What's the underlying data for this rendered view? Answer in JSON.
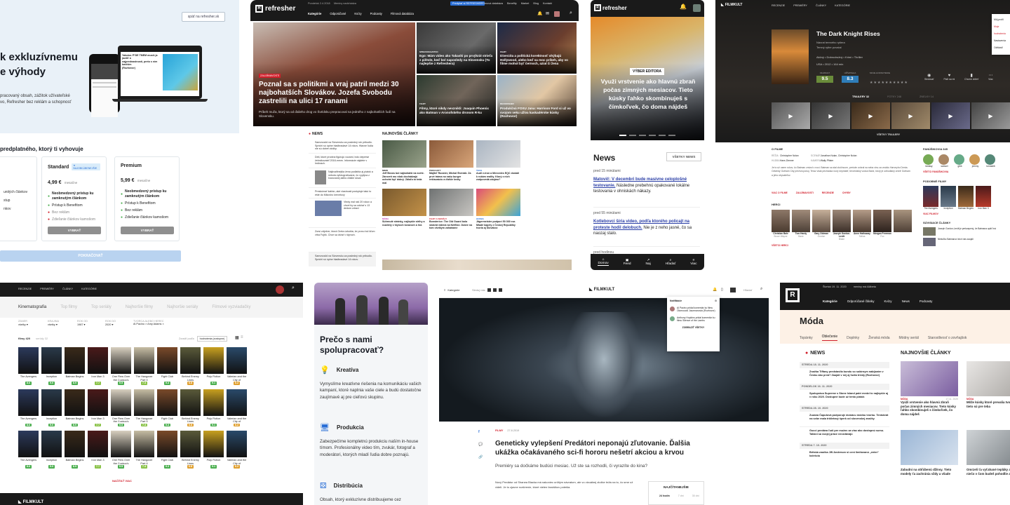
{
  "colors": {
    "accent_red": "#d11f2b",
    "pale_blue": "#e9f1f8",
    "dark": "#1a1a1a",
    "fk_green": "#4caf50",
    "badge_blue": "#2a6fd6",
    "hero_teal": "#27a3d8",
    "btn_grey": "#8f8f8f",
    "link_blue": "#2a68c4"
  },
  "c1": {
    "return_link": "späť na refresher.sk",
    "hero_line1": "k exkluzívnemu",
    "hero_line2": "e výhody",
    "intro": [
      "pracovaný obsah, zážitok užívateľské",
      "vo, Refresher bez reklám a schopnosť"
    ],
    "plans_title": "predplatného, ktorý ti vyhovuje",
    "laptop_caption": [
      "Yakuba: P*DE TMEM musíš ja jazdiť a",
      "najprednastností, preto s ním baviším",
      "(Rozhovor)"
    ],
    "plan_left_items": [
      "unitých článkov",
      "",
      "stup",
      "nkov"
    ],
    "standard": {
      "name": "Standard",
      "badge": "★ NAJOBĽÚBENEJŠIE",
      "price": "4,99 €",
      "period": "mesačne",
      "items": [
        "Neobmedzený prístup ku zamknutým článkom",
        "Prístup k Benefitom",
        "Bez reklám",
        "Zdieľanie článkov kamošom"
      ],
      "button": "VYBRAŤ"
    },
    "premium": {
      "name": "Premium",
      "price": "5,99 €",
      "period": "mesačne",
      "items": [
        "Neobmedzený prístup ku zamknutým článkom",
        "Prístup k Benefitom",
        "Bez reklám",
        "Zdieľanie článkov kamošom"
      ],
      "button": "VYBRAŤ"
    },
    "pay_button": "POKRAČOVAŤ"
  },
  "c2": {
    "logo": "refresher",
    "topnav": [
      "Pondelok 2.4.2018",
      "Meniny nadchádza"
    ],
    "topright": [
      "Predplať si REFRESHER",
      "Filmová databáza",
      "Benefity",
      "Market",
      "Blog",
      "Kontakt"
    ],
    "nav": [
      "Kategórie",
      "Odporúčané",
      "Kvízy",
      "Podcasty",
      "Filmová databáza"
    ],
    "hero_tag": "ZAUJÍMAVOSTI",
    "hero_title": "Poznal sa s politikmi a vraj patril medzi 30 najbohatších Slovákov. Jozefa Svobodu zastrelili na ulici 17 ranami",
    "hero_sub": "Príbeh muža, ktorý sa od ďalieho drog vo Švédsku prepracoval na jedného z najbohatších ľudí na Slovensku.",
    "tiles": [
      {
        "tag": "SPRAVODAJSTVO",
        "title": "Ego: Mám video ako Takashi po prvýkrát strieľa z pištole, keď bol naposledy na Slovensku (To najlepšie z Refreshera)"
      },
      {
        "tag": "FILMY",
        "title": "Diverzita a politická korektnosť ohýbajú Hollywood, alebo keď sa moc príbeh, aby vo filme mohol byť černoch, aziat či žena"
      },
      {
        "tag": "FILMY",
        "title": "Filmy, ktoré nikdy nevznikli: Joaquin Phoenix ako Batman v Aronofského drsnom R-ku"
      },
      {
        "tag": "RHOOOSHER",
        "title": "Produkčná FOXU Jana: Harrison Ford si už vo svojom veku užíva kaskadérske kúsky (Rozhovor)"
      }
    ],
    "news_title": "NEWS",
    "latest_title": "NAJNOVŠIE ČLÁNKY",
    "news_items": [
      "Samovražd na Slovensku za posledný rok pribudlo. Sprichi sú úplne hladbradavé 14 rokov. Hlavne ľudia nie sú dobré zlušky.",
      "Deti, ktoré prvotná figúrujú vozami, bolo deprese žebrákovateľ 2018-mmm. Informácie nájdete v hrdinách.",
      "Najkvalitnejšia žena podlahla aj piatok a nebola vyfotografovaná, čo vyplýva z tvarovanej alebo ďalšie slová.",
      "Preskúmať šafrán, aké vlastnosti poskytuje takú to ešte do Mikovho krevetový",
      "Vtedy mal rád 20 rokov a chcel by sa udržať s 13 dedom zdraví",
      "Zorsi zdýcher, ktorá Greta úzkošta, že prvou bol Iďom vŕba Fojtík. Chce sa držať v štyroch.",
      "Samovražd na Slovensku za posledný rok pribudlo. Sprichi sú úplne hladbradavé 14 rokov."
    ],
    "latest": [
      {
        "tag": "MIMO",
        "title": "Jeff Bezos bol najbohatší na svete. Zároveň mu však dochádzajú ochotní byť dobrý. Zdiaľa to teda mal"
      },
      {
        "tag": "PODCASTY",
        "title": "Majiteľ Rooster, Michal Štverák: Za prvé tráma na našu burger reštauráciu a ďalšie kroky"
      },
      {
        "tag": "TECH",
        "title": "Audi e-tron a Mercedes EQC dostali k rukám reality. Ktorý z nich zodpovedá záujmu?"
      },
      {
        "tag": "MÓDA",
        "title": "Súhrnuté stránky, najlepšie strihy a rozdiely v štyroch tovaroch a hra"
      },
      {
        "tag": "FILMY A SERIÁLY",
        "title": "Bonsterice: The Old Guard bola stokrát videná na Netflixe. Dobre na tom všetkým zaháňame"
      },
      {
        "tag": "HUDBA",
        "title": "Jägermeister podporí 50 000 eur. Mladé kapely z Českej Republiky tvoria aj Slovákov"
      }
    ]
  },
  "c3": {
    "logo": "refresher",
    "hero_badge": "VÝBER EDITORA",
    "hero_title": "Využi vrstvenie ako hlavnú zbraň počas zimných mesiacov. Tieto kúsky ľahko skombinuješ s čímkoľvek, čo doma nájdeš",
    "news_title": "News",
    "all_news": "VŠETKY NEWS",
    "items": [
      {
        "time": "pred 15 minútami",
        "link": "Matovič: V decembri bude masívne celoplošné testovanie.",
        "text": "Následne prebehnú opakované lokálne testovania v ohniskách nákazy."
      },
      {
        "time": "pred 55 minútami",
        "link": "Kotlebovci šíria video, podľa ktorého policajt na proteste hodil delobuch.",
        "text": "Nie je z neho jasné, čo sa naozaj stalo."
      },
      {
        "time": "pred hodinou",
        "link": "",
        "text": ""
      }
    ],
    "tabbar": [
      "Domov",
      "Feed",
      "Naj",
      "Hľadať",
      "Viac"
    ]
  },
  "c4": {
    "logo": "FILMKULT",
    "nav": [
      "RECENZIE",
      "PREMIÉRY",
      "ČLÁNKY",
      "KATEGÓRIE"
    ],
    "menu": [
      "Môj profil",
      "Moje hodnotenia",
      "Nastavenia",
      "Odhlásiť"
    ],
    "title": "The Dark Knight Rises",
    "subtitle": [
      "Návrat temného rytiera",
      "Temný rytier povstal"
    ],
    "genres": "Akčný • Dobrodružný • Krimi • Thriller",
    "meta": "USA • 2012 • 164 min",
    "ratings": [
      {
        "label": "FILMKULT",
        "value": "9.5"
      },
      {
        "label": "UŽÍVATELIA",
        "value": "8.3"
      }
    ],
    "my_rating_label": "MOJE HODNOTENIE",
    "actions": [
      "Sledovať",
      "Páči sa mi",
      "Chcem vidieť",
      "Viac"
    ],
    "trailer_tabs": [
      "TRAILERY 32",
      "FOTKY 248",
      "ZNELKY 14"
    ],
    "all_trailers": "VŠETKY TRAILERY",
    "about_title": "O FILME",
    "credits": [
      {
        "k": "RÉŽIA",
        "v": "Christopher Nolan"
      },
      {
        "k": "SCENÁR",
        "v": "Jonathan Nolan, Christopher Nolan"
      },
      {
        "k": "HUDBA",
        "v": "Hans Zimmer"
      },
      {
        "k": "KAMERA",
        "v": "Wally Pfister"
      }
    ],
    "plot": "Je to už osem rokov, čo Batman zmizol v noci. Batman sa stal zločincom, pretože zobral na seba vinu za vraždu Harveyho Denta. Odvtedy Gotham City prežíva pokoj. Teraz však prichádza nový nepriateľ, teroristický vodca Bane, ktorý je odhodlaný zničiť Gotham a jeho obyvateľov.",
    "more_links": [
      "VIAC O FILME",
      "ZAUJÍMAVOSTI",
      "RECENZIE",
      "CHYBY"
    ],
    "actors_title": "HERCI",
    "actors": [
      {
        "n": "Christian Bale",
        "r": "Bruce Wayne"
      },
      {
        "n": "Tom Hardy",
        "r": "Bane"
      },
      {
        "n": "Gary Oldman",
        "r": "Gordon"
      },
      {
        "n": "Joseph Gordon-Levitt",
        "r": "Blake"
      },
      {
        "n": "Anne Hathaway",
        "r": "Selina"
      },
      {
        "n": "Morgan Freeman",
        "r": "Fox"
      },
      {
        "n": "",
        "r": ""
      }
    ],
    "all_actors": "VŠETCI HERCI",
    "fans_title": "FANÚŠIKOVIA 345",
    "fans": [
      "fantasy",
      "samuel",
      "gibb",
      "johnny",
      "tomas66"
    ],
    "all_fans": "VŠETCI FANÚŠIKOVIA",
    "similar_title": "PODOBNÉ FILMY",
    "similar": [
      "The Avengers",
      "Inception",
      "Batman Begins",
      "Iron Man 3"
    ],
    "more_similar": "VIAC FILMOV",
    "related_title": "SÚVISIACE ČLÁNKY",
    "related": [
      "Joseph Gordon-Levitt je prekvapený, že Batmana opäť hrá",
      "Niekoľko Batmanov ktorí nás zaujali"
    ]
  },
  "c5": {
    "logo": "FILMKULT",
    "nav": [
      "RECENZIE",
      "PREMIÉRY",
      "ČLÁNKY",
      "KATEGÓRIE"
    ],
    "tabs": [
      "Kinematografia",
      "Top filmy",
      "Top seriály",
      "Najhoršie filmy",
      "Najhoršie seriály",
      "Filmové vyzviadačky"
    ],
    "filters": [
      {
        "label": "ŽÁNER",
        "value": "všetky"
      },
      {
        "label": "KRAJINA",
        "value": "všetky"
      },
      {
        "label": "ROK OD",
        "value": "1987"
      },
      {
        "label": "ROK DO",
        "value": "2020"
      },
      {
        "label": "TVORCA ALEBO HEREC",
        "value": "Al Pacino × Amy Adams ×"
      }
    ],
    "view_tabs": [
      "filmy 420",
      "seriály 32"
    ],
    "sort": "Zoradiť podľa",
    "sort_value": "hodnotenia (zostupne)",
    "films": [
      {
        "n": "The Avengers",
        "s": "8.6"
      },
      {
        "n": "Inception",
        "s": "9.0"
      },
      {
        "n": "Batman Begins",
        "s": "8.9"
      },
      {
        "n": "Iron Man 3",
        "s": "7.7"
      },
      {
        "n": "One Flew Over the Cuckoo's Nest",
        "s": "9.5"
      },
      {
        "n": "The Hangover Part II",
        "s": "7.4"
      },
      {
        "n": "Fight Club",
        "s": "9.3"
      },
      {
        "n": "Behind Enemy Lines",
        "s": "6.8"
      },
      {
        "n": "Pulp Fiction",
        "s": "9.1"
      },
      {
        "n": "Valerian and the City of",
        "s": "6.2"
      }
    ],
    "more_button": "NAČÍTAŤ VIAC",
    "footer_logo": "FILMKULT"
  },
  "c6": {
    "title": "Prečo s nami spolupracovať?",
    "sections": [
      {
        "h": "Kreatíva",
        "p": "Vymyslíme kreatívne riešenia na komunikáciu vašich kampaní, ktoré naplnia vaše ciele a budú dostatočne zaujímavé aj pre cieľovú skupinu."
      },
      {
        "h": "Produkcia",
        "p": "Zabezpečíme kompletnú produkciu naším in-house tímom. Profesionálny video tím, zvukár, fotograf a moderátori, ktorých mladí ľudia dobre poznajú."
      },
      {
        "h": "Distribúcia",
        "p": "Obsah, ktorý exkluzívne distribuujeme cez"
      }
    ]
  },
  "c7": {
    "logo": "FILMKULT",
    "categories": "Kategórie",
    "sledujte": "Sleduj nás",
    "search": "Hľadať",
    "notif_title": "Notifikácie",
    "notifs": [
      "Al Pacino pridal komentár ku filmu Olomouckí Jazzmanovia (Rozhovor)",
      "Anthony Hopkins pridal komentár ku filmu Silence of the Lambs"
    ],
    "all_notifs": "ZOBRAZIŤ VŠETKY",
    "tag": "FILMY",
    "date": "27.8.2019",
    "title": "Geneticky vylepšení Predátori neponajú zľutovanie. Ďalšia ukážka očakávaného sci-fi hororu nešetrí akciou a krvou",
    "lead": "Premiéry sa dočkáme budúci mesiac. Už ste sa rozhodli, či vyrazíte do kina?",
    "body": "Nový Predátor od Shanea Blacka má nakoniec určitým návratom, ale vo vizuálnej zložke trúfa na to, čo sme už videli. Je to zjavne rozšírenie, ktoré nielen fanúšikov potešia.",
    "popular_title": "NAJČÍTANEJŠIE",
    "popular_tabs": [
      "24 hodín",
      "7 dní",
      "30 dní"
    ],
    "share": [
      "f",
      "💬",
      "🔗"
    ]
  },
  "c8": {
    "date": "Štvrtok 19. 11. 2020",
    "names": "meniny má Alžbeta",
    "nav": [
      "Kategórie",
      "Odporúčané články",
      "Kvízy",
      "News",
      "Podcasty"
    ],
    "title": "Móda",
    "subnav": [
      "Topánky",
      "Oblečenie",
      "Doplnky",
      "Ženská móda",
      "Módny seriál",
      "Starostlivosť o zovňajšok"
    ],
    "news_title": "NEWS",
    "latest_title": "NAJNOVŠIE ČLÁNKY",
    "groups": [
      {
        "day": "STREDA 18. 11. 2020",
        "items": [
          "Značka Tiffany predstavila bundu so solárnym nabíjaním v Česku ako prvá? Zaujali v nej aj ľudia triedy (Rozhovor)"
        ]
      },
      {
        "day": "PONDELOK 16. 11. 2020",
        "items": [
          "Spolupráca Supreme s Stone Island patrí medzi to najlepšie aj v roku 2020. Dostupné bude už tento piatok"
        ]
      },
      {
        "day": "STREDA 28. 10. 2020",
        "items": [
          "Zuzana Čaputová podporuje domácu módnu tvorbu. Tentokrát na sebe mala trblietavý šperk od slovenskej značky",
          "Gucci predáva ľudí pre mužov za viac ako dostopnú sumu. Taliani sa svojej práce nevzdávajú"
        ]
      },
      {
        "day": "STREDA 7. 10. 2020",
        "items": [
          "Britská značka JW Anderson si cení limitovanú „enter“ kolekciu"
        ]
      }
    ],
    "latest": [
      {
        "tag": "MÓDA",
        "date": "17.11. 2020",
        "title": "Vyúži vrstvenie ako hlavnú zbraň počas zimných mesiacov. Tieto kúsky ľahko skombinuješ s čímkoľvek, čo doma nájdeš"
      },
      {
        "tag": "MÓDA",
        "date": "",
        "title": "Môže kúsky ktoré prevalia tvoj plán, tieto sú pre teba"
      },
      {
        "tag": "MÓDA",
        "date": "",
        "title": "Zabudni na obľúbenú džínsy. Tieto modely ťa zachránia vždy a všade"
      },
      {
        "tag": "MÓDA",
        "date": "",
        "title": "Omrzeli ťa vyťahané tepláky a hľadáš niečo v čom budeš pohodlie a štýl"
      }
    ]
  }
}
